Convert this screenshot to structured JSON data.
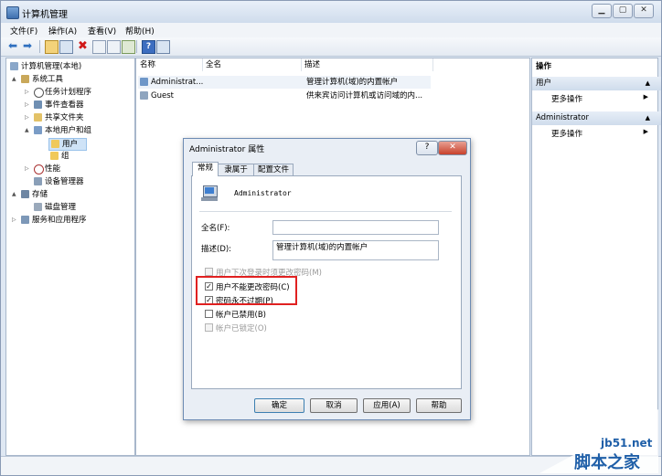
{
  "window": {
    "title": "计算机管理"
  },
  "menu": [
    "文件(F)",
    "操作(A)",
    "查看(V)",
    "帮助(H)"
  ],
  "tree": [
    {
      "label": "计算机管理(本地)",
      "level": 0,
      "arrow": ""
    },
    {
      "label": "系统工具",
      "level": 1,
      "arrow": "▲"
    },
    {
      "label": "任务计划程序",
      "level": 2,
      "arrow": "▷"
    },
    {
      "label": "事件查看器",
      "level": 2,
      "arrow": "▷"
    },
    {
      "label": "共享文件夹",
      "level": 2,
      "arrow": "▷"
    },
    {
      "label": "本地用户和组",
      "level": 2,
      "arrow": "▲"
    },
    {
      "label": "用户",
      "level": 3,
      "arrow": ""
    },
    {
      "label": "组",
      "level": 3,
      "arrow": ""
    },
    {
      "label": "性能",
      "level": 2,
      "arrow": "▷"
    },
    {
      "label": "设备管理器",
      "level": 2,
      "arrow": ""
    },
    {
      "label": "存储",
      "level": 1,
      "arrow": "▲"
    },
    {
      "label": "磁盘管理",
      "level": 2,
      "arrow": ""
    },
    {
      "label": "服务和应用程序",
      "level": 1,
      "arrow": "▷"
    }
  ],
  "list": {
    "columns": [
      "名称",
      "全名",
      "描述"
    ],
    "rows": [
      {
        "name": "Administrat...",
        "fullname": "",
        "desc": "管理计算机(域)的内置帐户"
      },
      {
        "name": "Guest",
        "fullname": "",
        "desc": "供来宾访问计算机或访问域的内..."
      }
    ]
  },
  "actions": {
    "header": "操作",
    "sections": [
      {
        "title": "用户",
        "item": "更多操作"
      },
      {
        "title": "Administrator",
        "item": "更多操作"
      }
    ]
  },
  "dialog": {
    "title": "Administrator 属性",
    "help_glyph": "?",
    "close_glyph": "✕",
    "tabs": [
      "常规",
      "隶属于",
      "配置文件"
    ],
    "username": "Administrator",
    "fullname_label": "全名(F):",
    "fullname_value": "",
    "desc_label": "描述(D):",
    "desc_value": "管理计算机(域)的内置帐户",
    "checkboxes": [
      {
        "label": "用户下次登录时须更改密码(M)",
        "checked": false,
        "disabled": true
      },
      {
        "label": "用户不能更改密码(C)",
        "checked": true,
        "disabled": false
      },
      {
        "label": "密码永不过期(P)",
        "checked": true,
        "disabled": false
      },
      {
        "label": "帐户已禁用(B)",
        "checked": false,
        "disabled": false
      },
      {
        "label": "帐户已锁定(O)",
        "checked": false,
        "disabled": true
      }
    ],
    "buttons": [
      "确定",
      "取消",
      "应用(A)",
      "帮助"
    ]
  },
  "watermark": {
    "line1": "jb51.net",
    "line2": "脚本之家"
  }
}
